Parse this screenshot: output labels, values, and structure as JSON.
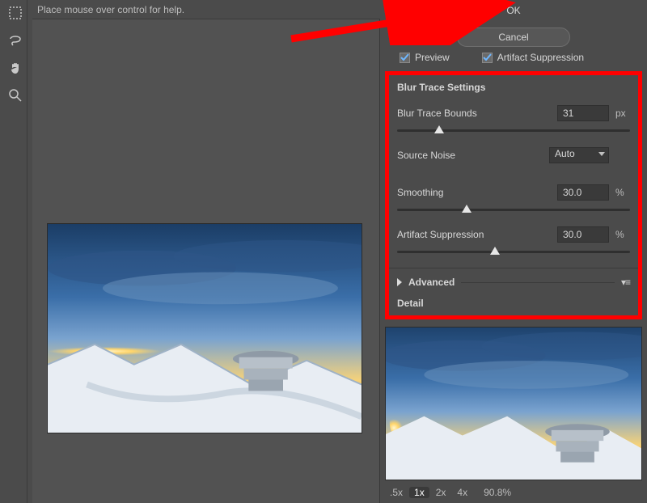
{
  "helpbar": {
    "text": "Place mouse over control for help."
  },
  "tools": {
    "marquee": "marquee-tool",
    "lasso": "lasso-tool",
    "hand": "hand-tool",
    "zoom": "zoom-tool"
  },
  "buttons": {
    "ok": "OK",
    "cancel": "Cancel"
  },
  "checkboxes": {
    "preview": {
      "label": "Preview",
      "checked": true
    },
    "artifact": {
      "label": "Artifact Suppression",
      "checked": true
    }
  },
  "settings": {
    "title": "Blur Trace Settings",
    "blur_trace_bounds": {
      "label": "Blur Trace Bounds",
      "value": "31",
      "unit": "px",
      "slider_pct": 18
    },
    "source_noise": {
      "label": "Source Noise",
      "value": "Auto"
    },
    "smoothing": {
      "label": "Smoothing",
      "value": "30.0",
      "unit": "%",
      "slider_pct": 30
    },
    "artifact_suppression": {
      "label": "Artifact Suppression",
      "value": "30.0",
      "unit": "%",
      "slider_pct": 42
    }
  },
  "advanced": {
    "label": "Advanced"
  },
  "detail": {
    "title": "Detail"
  },
  "zoom": {
    "levels": [
      ".5x",
      "1x",
      "2x",
      "4x"
    ],
    "active_index": 1,
    "percent": "90.8%"
  }
}
